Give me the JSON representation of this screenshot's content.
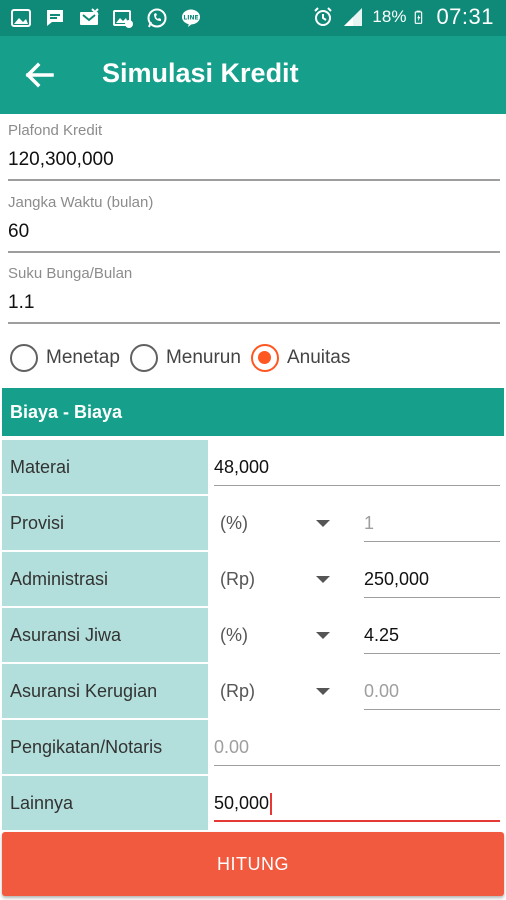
{
  "status_bar": {
    "battery_percent": "18%",
    "time": "07:31",
    "icons": [
      "gallery-icon",
      "message-icon",
      "missed-call-icon",
      "image-mail-icon",
      "whatsapp-icon",
      "line-icon"
    ]
  },
  "app_bar": {
    "title": "Simulasi Kredit"
  },
  "form": {
    "plafond": {
      "label": "Plafond Kredit",
      "value": "120,300,000"
    },
    "jangka": {
      "label": "Jangka Waktu (bulan)",
      "value": "60"
    },
    "suku": {
      "label": "Suku Bunga/Bulan",
      "value": "1.1"
    }
  },
  "radio": {
    "options": [
      "Menetap",
      "Menurun",
      "Anuitas"
    ],
    "selected": "Anuitas"
  },
  "biaya": {
    "header": "Biaya - Biaya",
    "rows": [
      {
        "label": "Materai",
        "value": "48,000"
      },
      {
        "label": "Provisi",
        "unit": "(%)",
        "placeholder": "1"
      },
      {
        "label": "Administrasi",
        "unit": "(Rp)",
        "value": "250,000"
      },
      {
        "label": "Asuransi Jiwa",
        "unit": "(%)",
        "value": "4.25"
      },
      {
        "label": "Asuransi Kerugian",
        "unit": "(Rp)",
        "placeholder": "0.00"
      },
      {
        "label": "Pengikatan/Notaris",
        "placeholder": "0.00"
      },
      {
        "label": "Lainnya",
        "value": "50,000"
      }
    ]
  },
  "button": {
    "label": "HITUNG"
  },
  "colors": {
    "primary": "#16a08b",
    "primary_dark": "#0f8a78",
    "label_bg": "#b2dfdb",
    "accent": "#ff5722",
    "button": "#f15a3f"
  }
}
